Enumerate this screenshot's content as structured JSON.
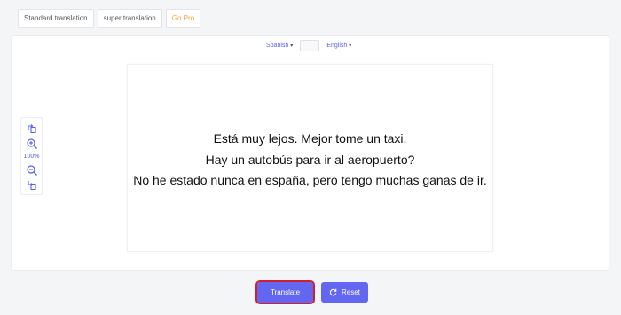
{
  "mode_tabs": [
    "Standard translation",
    "super translation",
    "Go Pro"
  ],
  "languages": {
    "source": "Spanish",
    "target": "English"
  },
  "document": {
    "lines": [
      "Está muy lejos. Mejor tome un taxi.",
      "Hay un autobús para ir al aeropuerto?",
      "No he estado nunca en españa, pero tengo muchas ganas de ir."
    ]
  },
  "zoom": {
    "level": "100%"
  },
  "actions": {
    "translate_label": "Translate",
    "reset_label": "Reset"
  },
  "colors": {
    "accent": "#6366f1",
    "pro": "#f0a23b",
    "highlight_border": "#d11f2e"
  },
  "icons": [
    "rotate-left-icon",
    "zoom-in-icon",
    "zoom-out-icon",
    "rotate-right-icon",
    "refresh-icon",
    "caret-down-icon"
  ]
}
